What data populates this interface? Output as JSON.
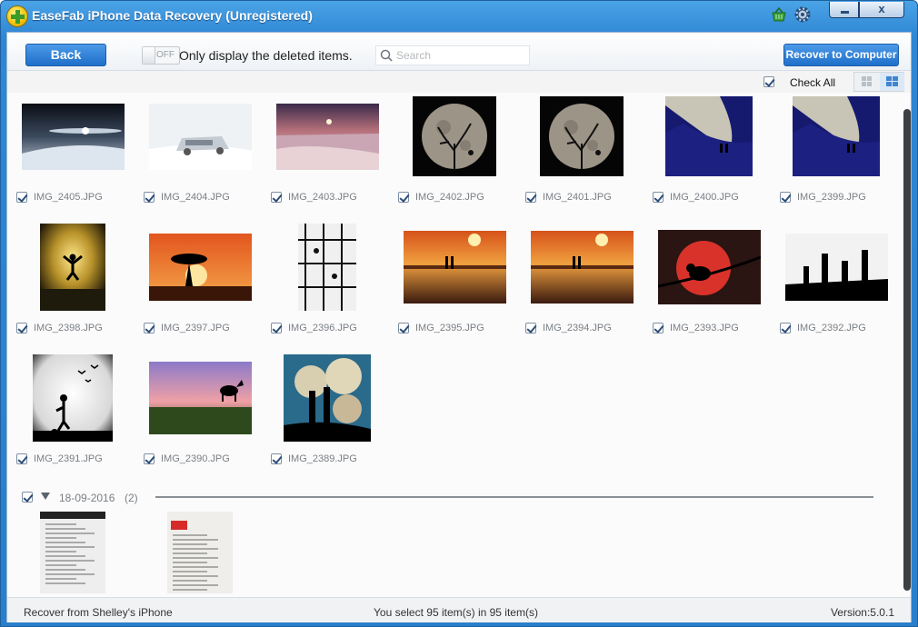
{
  "window": {
    "title": "EaseFab iPhone Data Recovery (Unregistered)",
    "close_glyph": "x"
  },
  "toolbar": {
    "back_label": "Back",
    "toggle_state": "OFF",
    "toggle_label": "Only display the deleted items.",
    "search_placeholder": "Search",
    "search_value": "",
    "recover_label": "Recover to Computer"
  },
  "view": {
    "check_all_label": "Check All",
    "check_all_checked": true,
    "active_view": "grid"
  },
  "photos": [
    {
      "name": "IMG_2405.JPG",
      "checked": true,
      "scene": "light-trails-snow"
    },
    {
      "name": "IMG_2404.JPG",
      "checked": true,
      "scene": "snowed-car"
    },
    {
      "name": "IMG_2403.JPG",
      "checked": true,
      "scene": "snow-sunset"
    },
    {
      "name": "IMG_2402.JPG",
      "checked": true,
      "scene": "moon-tree"
    },
    {
      "name": "IMG_2401.JPG",
      "checked": true,
      "scene": "moon-tree"
    },
    {
      "name": "IMG_2400.JPG",
      "checked": true,
      "scene": "couple-dune"
    },
    {
      "name": "IMG_2399.JPG",
      "checked": true,
      "scene": "couple-dune"
    },
    {
      "name": "IMG_2398.JPG",
      "checked": true,
      "scene": "jump-sunset"
    },
    {
      "name": "IMG_2397.JPG",
      "checked": true,
      "scene": "tree-sunset"
    },
    {
      "name": "IMG_2396.JPG",
      "checked": true,
      "scene": "scaffold-climbers"
    },
    {
      "name": "IMG_2395.JPG",
      "checked": true,
      "scene": "beach-sunset"
    },
    {
      "name": "IMG_2394.JPG",
      "checked": true,
      "scene": "beach-sunset"
    },
    {
      "name": "IMG_2393.JPG",
      "checked": true,
      "scene": "bird-branch"
    },
    {
      "name": "IMG_2392.JPG",
      "checked": true,
      "scene": "group-silhouette"
    },
    {
      "name": "IMG_2391.JPG",
      "checked": true,
      "scene": "soccer-birds"
    },
    {
      "name": "IMG_2390.JPG",
      "checked": true,
      "scene": "horse-field"
    },
    {
      "name": "IMG_2389.JPG",
      "checked": true,
      "scene": "couple-clouds"
    }
  ],
  "group": {
    "date": "18-09-2016",
    "count": "(2)",
    "checked": true,
    "photos": [
      {
        "scene": "document"
      },
      {
        "scene": "document-red"
      }
    ]
  },
  "status": {
    "left": "Recover from Shelley's iPhone",
    "center": "You select 95 item(s) in 95 item(s)",
    "right": "Version:5.0.1"
  },
  "colors": {
    "accent": "#2a7fcd",
    "button": "#1f6fca",
    "title_bar": "#4aa3e6"
  },
  "icons": {
    "logo": "easefab-plus-icon",
    "basket": "basket-icon",
    "settings": "gear-icon",
    "search": "search-icon"
  }
}
